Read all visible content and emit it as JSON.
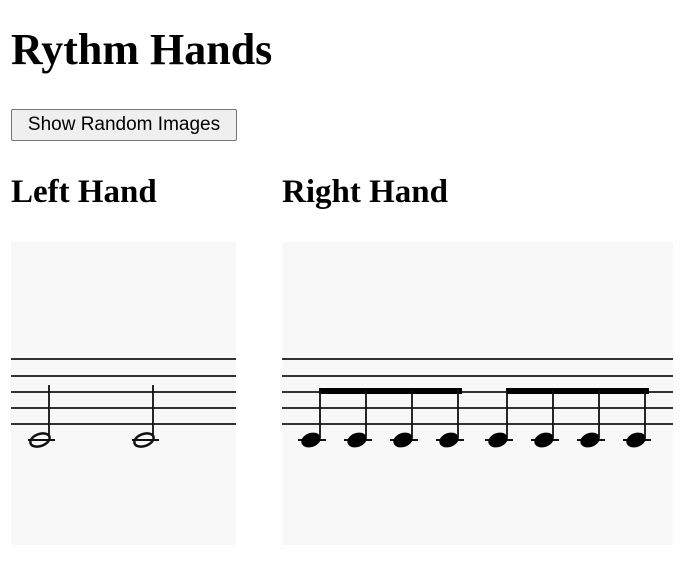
{
  "page": {
    "title": "Rythm Hands"
  },
  "controls": {
    "random_button_label": "Show Random Images"
  },
  "left_hand": {
    "heading": "Left Hand",
    "image": {
      "staff_lines": 5,
      "notes": [
        {
          "kind": "half-note"
        },
        {
          "kind": "half-note"
        }
      ]
    }
  },
  "right_hand": {
    "heading": "Right Hand",
    "image": {
      "staff_lines": 5,
      "beam_groups": [
        {
          "kind": "eighth-notes",
          "count": 4
        },
        {
          "kind": "eighth-notes",
          "count": 4
        }
      ]
    }
  }
}
